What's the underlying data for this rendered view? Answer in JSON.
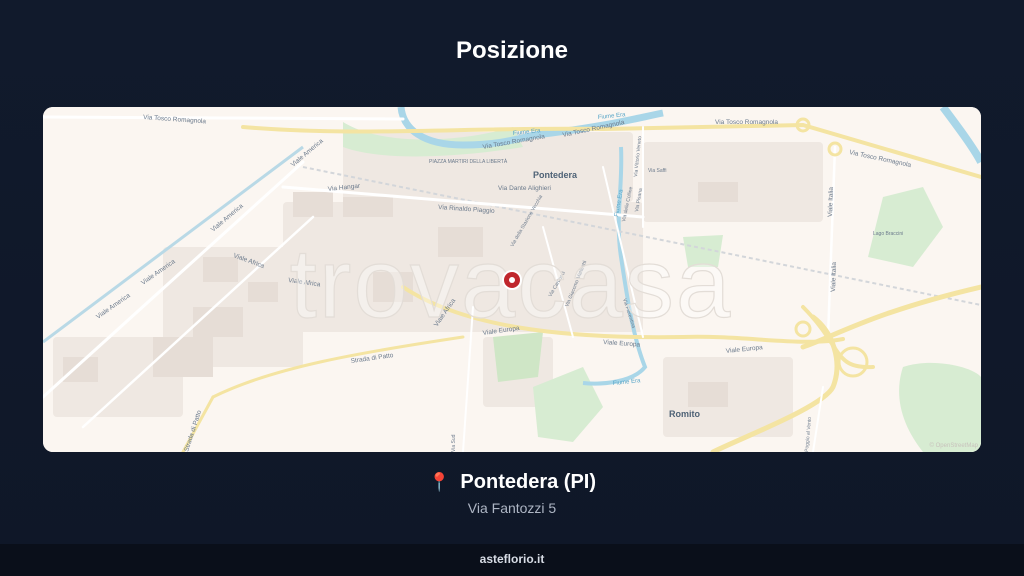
{
  "page_title": "Posizione",
  "map": {
    "watermark": "trovacasa",
    "attribution": "© OpenStreetMap",
    "town_labels": [
      "Pontedera",
      "Romito"
    ],
    "street_labels": [
      "Via Tosco Romagnola",
      "Via Tosco Romagnola",
      "Via Tosco Romagnola",
      "Via Tosco Romagnola",
      "Via Tosco Romagnola",
      "Viale America",
      "Viale America",
      "Viale America",
      "Viale America",
      "Via Hangar",
      "Via Rinaldo Piaggio",
      "Via Dante Alighieri",
      "Viale Africa",
      "Viale Africa",
      "Viale Africa",
      "Viale Europa",
      "Viale Europa",
      "Viale Europa",
      "Strada di Patto",
      "Strada di Patto",
      "Viale Italia",
      "Viale Italia",
      "Via Saffi",
      "Via Vittorio Veneto",
      "Via delle Colline",
      "Via Fiorentina",
      "Via della Stazione Vecchia",
      "Via Pisana",
      "Via Sud",
      "Poggio al Vento",
      "Via Carducci",
      "Via Giacomo Matteotti"
    ],
    "water_labels": [
      "Fiume Era",
      "Fiume Era",
      "Fiume Era",
      "Fiume Era"
    ],
    "poi_labels": [
      "PIAZZA MARTIRI DELLA LIBERTÀ",
      "Lago Braccini"
    ],
    "marker": "location-marker"
  },
  "location": {
    "city": "Pontedera (PI)",
    "address": "Via Fantozzi 5",
    "pin_icon": "📍"
  },
  "footer": {
    "brand": "asteflorio.it"
  },
  "colors": {
    "background": "#111a2c",
    "map_base": "#fbf6f1",
    "road_major": "#f7e6a6",
    "water": "#a9d6e8",
    "park": "#d7ecd2",
    "marker": "#c0272d"
  }
}
